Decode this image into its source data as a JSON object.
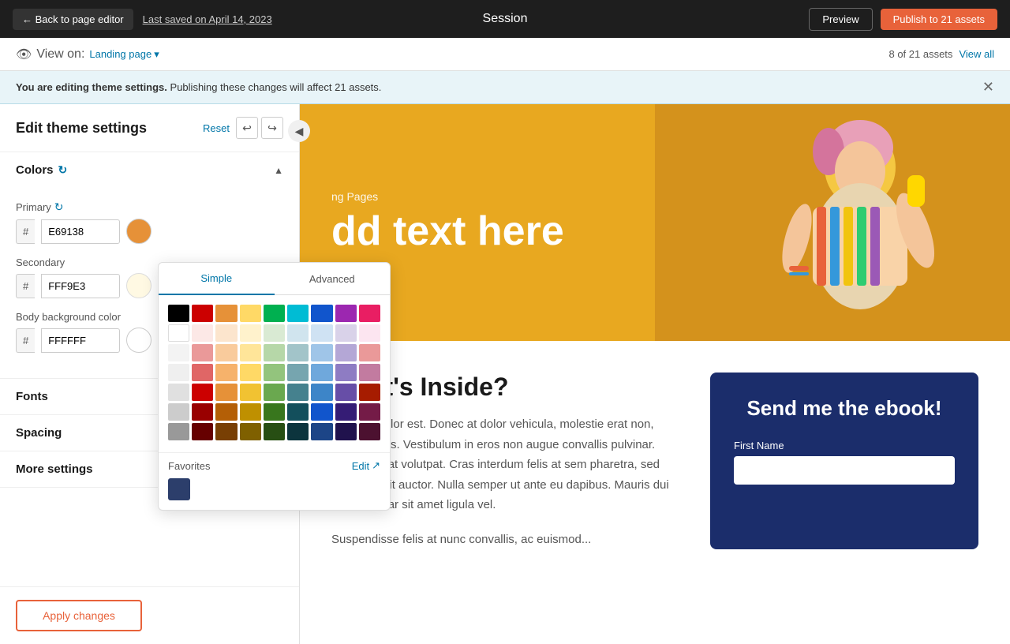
{
  "topbar": {
    "back_label": "← Back to page editor",
    "last_saved": "Last saved on April 14, 2023",
    "page_title": "Session",
    "preview_label": "Preview",
    "publish_label": "Publish to 21 assets"
  },
  "viewbar": {
    "view_on_label": "View on:",
    "landing_page_label": "Landing page",
    "assets_count": "8 of 21 assets",
    "view_all_label": "View all"
  },
  "notification": {
    "main_text": "You are editing theme settings.",
    "sub_text": "Publishing these changes will affect 21 assets."
  },
  "left_panel": {
    "title": "Edit theme settings",
    "reset_label": "Reset",
    "collapse_icon": "◀",
    "sections": {
      "colors": {
        "label": "Colors",
        "expanded": true,
        "primary": {
          "label": "Primary",
          "value": "E69138",
          "swatch_color": "#E69138"
        },
        "secondary": {
          "label": "Secondary",
          "value": "FFF9E3",
          "swatch_color": "#FFF9E3"
        },
        "body_bg": {
          "label": "Body background color",
          "value": "FFFFFF",
          "swatch_color": "#FFFFFF"
        }
      },
      "fonts": {
        "label": "Fonts"
      },
      "spacing": {
        "label": "Spacing"
      },
      "more_settings": {
        "label": "More settings"
      }
    }
  },
  "color_picker": {
    "tab_simple": "Simple",
    "tab_advanced": "Advanced",
    "active_tab": "simple",
    "favorites_label": "Favorites",
    "edit_label": "Edit",
    "fav_color": "#2c3e6b",
    "color_rows": [
      [
        "#000000",
        "#cc0000",
        "#e69138",
        "#ffd966",
        "#00b050",
        "#00b0c0",
        "#1155cc",
        "#674ea7",
        "#c90076"
      ],
      [
        "#ffffff",
        "#f4cccc",
        "#fce5cd",
        "#fff2cc",
        "#d9ead3",
        "#d0e4f0",
        "#cfe2f3",
        "#d9d2e9",
        "#fce5cd"
      ],
      [
        "#f3f3f3",
        "#ea9999",
        "#f9cb9c",
        "#ffe599",
        "#b6d7a8",
        "#a2c4c9",
        "#9fc5e8",
        "#b4a7d6",
        "#ea9999"
      ],
      [
        "#efefef",
        "#e06666",
        "#f6b26b",
        "#ffd966",
        "#93c47d",
        "#76a5af",
        "#6fa8dc",
        "#8e7cc3",
        "#c27ba0"
      ],
      [
        "#e0e0e0",
        "#cc0000",
        "#e69138",
        "#f1c232",
        "#6aa84f",
        "#45818e",
        "#3d85c8",
        "#674ea7",
        "#a61c00"
      ],
      [
        "#cccccc",
        "#990000",
        "#b45f06",
        "#bf9000",
        "#38761d",
        "#134f5c",
        "#1155cc",
        "#351c75",
        "#741b47"
      ],
      [
        "#999999",
        "#660000",
        "#783f04",
        "#7f6000",
        "#274e13",
        "#0c343d",
        "#1c4587",
        "#20124d",
        "#4c1130"
      ]
    ]
  },
  "apply_button": {
    "label": "Apply changes"
  },
  "preview": {
    "hero": {
      "subtitle": "ng Pages",
      "title": "dd text here"
    },
    "content": {
      "heading": "What's Inside?",
      "body": "Morbi et dolor est. Donec at dolor vehicula, molestie erat non, rutrum tellus. Vestibulum in eros non augue convallis pulvinar. Aliquam erat volutpat. Cras interdum felis at sem pharetra, sed convallis elit auctor. Nulla semper ut ante eu dapibus. Mauris dui orci, pulvinar sit amet ligula vel.\n\nSuspendisse felis at nunc convallis, ac euismod..."
    },
    "form": {
      "title": "Send me the ebook!",
      "first_name_label": "First Name",
      "first_name_placeholder": ""
    }
  }
}
